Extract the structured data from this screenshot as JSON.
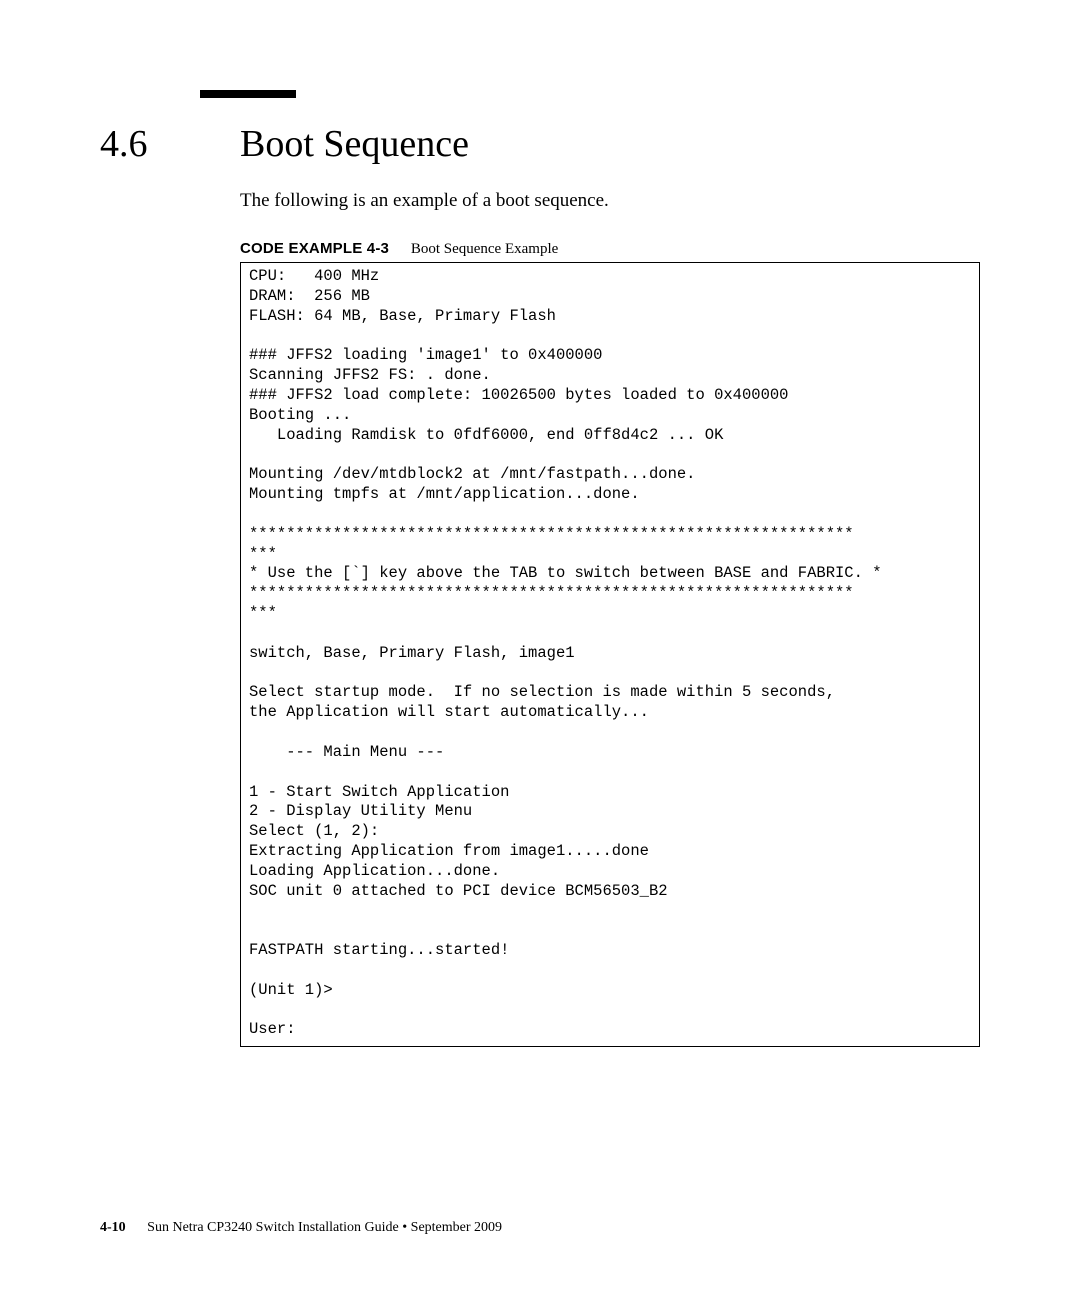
{
  "section": {
    "number": "4.6",
    "title": "Boot Sequence",
    "intro": "The following is an example of a boot sequence."
  },
  "code_example": {
    "label": "CODE EXAMPLE 4-3",
    "title": "Boot Sequence Example",
    "content": "CPU:   400 MHz\nDRAM:  256 MB\nFLASH: 64 MB, Base, Primary Flash\n\n### JFFS2 loading 'image1' to 0x400000\nScanning JFFS2 FS: . done.\n### JFFS2 load complete: 10026500 bytes loaded to 0x400000\nBooting ...\n   Loading Ramdisk to 0fdf6000, end 0ff8d4c2 ... OK\n\nMounting /dev/mtdblock2 at /mnt/fastpath...done.\nMounting tmpfs at /mnt/application...done.\n\n*****************************************************************\n***\n* Use the [`] key above the TAB to switch between BASE and FABRIC. *\n*****************************************************************\n***\n\nswitch, Base, Primary Flash, image1\n\nSelect startup mode.  If no selection is made within 5 seconds,\nthe Application will start automatically...\n\n    --- Main Menu ---\n\n1 - Start Switch Application\n2 - Display Utility Menu\nSelect (1, 2):\nExtracting Application from image1.....done\nLoading Application...done.\nSOC unit 0 attached to PCI device BCM56503_B2\n\n\nFASTPATH starting...started!\n\n(Unit 1)>\n\nUser:"
  },
  "footer": {
    "page_num": "4-10",
    "text": "Sun Netra CP3240 Switch Installation Guide • September 2009"
  }
}
